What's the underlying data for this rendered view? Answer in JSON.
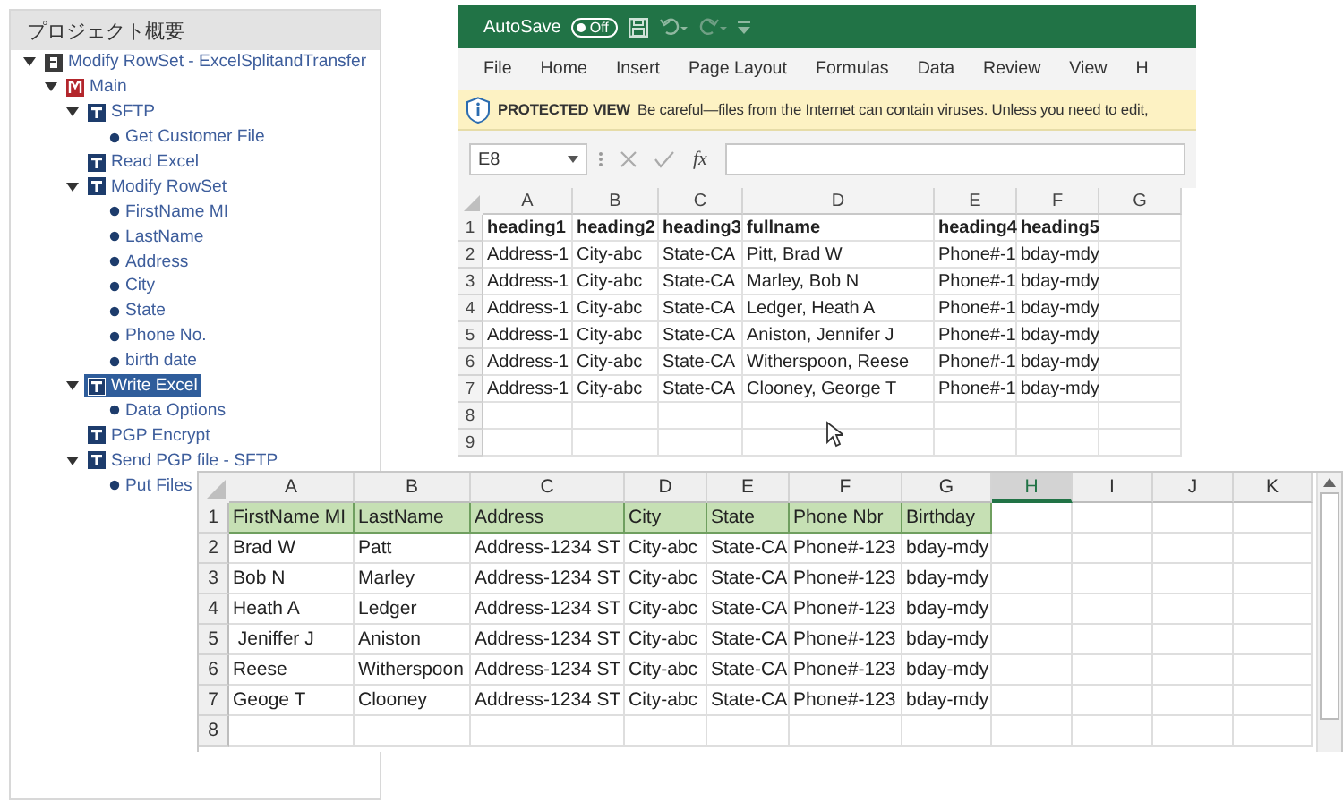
{
  "tree_panel": {
    "title": "プロジェクト概要",
    "items": [
      {
        "label": "Modify RowSet - ExcelSplitandTransfer",
        "kind": "project",
        "expanded": true,
        "selected": false,
        "children": [
          {
            "label": "Main",
            "kind": "module",
            "expanded": true,
            "selected": false,
            "children": [
              {
                "label": "SFTP",
                "kind": "task",
                "expanded": true,
                "selected": false,
                "children": [
                  {
                    "label": "Get Customer File",
                    "kind": "item",
                    "selected": false
                  }
                ]
              },
              {
                "label": "Read Excel",
                "kind": "task",
                "selected": false
              },
              {
                "label": "Modify RowSet",
                "kind": "task",
                "expanded": true,
                "selected": false,
                "children": [
                  {
                    "label": "FirstName MI",
                    "kind": "item",
                    "selected": false
                  },
                  {
                    "label": "LastName",
                    "kind": "item",
                    "selected": false
                  },
                  {
                    "label": "Address",
                    "kind": "item",
                    "selected": false
                  },
                  {
                    "label": "City",
                    "kind": "item",
                    "selected": false
                  },
                  {
                    "label": "State",
                    "kind": "item",
                    "selected": false
                  },
                  {
                    "label": "Phone No.",
                    "kind": "item",
                    "selected": false
                  },
                  {
                    "label": "birth date",
                    "kind": "item",
                    "selected": false
                  }
                ]
              },
              {
                "label": "Write Excel",
                "kind": "task",
                "expanded": true,
                "selected": true,
                "children": [
                  {
                    "label": "Data Options",
                    "kind": "item",
                    "selected": false
                  }
                ]
              },
              {
                "label": "PGP Encrypt",
                "kind": "task",
                "selected": false
              },
              {
                "label": "Send PGP file - SFTP",
                "kind": "task",
                "expanded": true,
                "selected": false,
                "children": [
                  {
                    "label": "Put Files",
                    "kind": "item",
                    "selected": false
                  }
                ]
              }
            ]
          }
        ]
      }
    ]
  },
  "excel_window": {
    "autosave": {
      "label": "AutoSave",
      "state_text": "Off",
      "on": false
    },
    "ribbon_tabs": [
      "File",
      "Home",
      "Insert",
      "Page Layout",
      "Formulas",
      "Data",
      "Review",
      "View",
      "H"
    ],
    "protected_view": {
      "title": "PROTECTED VIEW",
      "message": "Be careful—files from the Internet can contain viruses. Unless you need to edit,"
    },
    "name_box": "E8",
    "function_label": "fx",
    "sheet": {
      "columns": [
        "A",
        "B",
        "C",
        "D",
        "E",
        "F",
        "G"
      ],
      "rows": [
        {
          "number": "1",
          "kind": "header",
          "cells": [
            "heading1",
            "heading2",
            "heading3",
            "fullname",
            "heading4",
            "heading5"
          ]
        },
        {
          "number": "2",
          "kind": "data",
          "cells": [
            "Address-1",
            "City-abc",
            "State-CA",
            "Pitt, Brad W",
            "Phone#-1",
            "bday-mdy"
          ]
        },
        {
          "number": "3",
          "kind": "data",
          "cells": [
            "Address-1",
            "City-abc",
            "State-CA",
            "Marley, Bob N",
            "Phone#-1",
            "bday-mdy"
          ]
        },
        {
          "number": "4",
          "kind": "data",
          "cells": [
            "Address-1",
            "City-abc",
            "State-CA",
            "Ledger, Heath A",
            "Phone#-1",
            "bday-mdy"
          ]
        },
        {
          "number": "5",
          "kind": "data",
          "cells": [
            "Address-1",
            "City-abc",
            "State-CA",
            "Aniston, Jennifer J",
            "Phone#-1",
            "bday-mdy"
          ]
        },
        {
          "number": "6",
          "kind": "data",
          "cells": [
            "Address-1",
            "City-abc",
            "State-CA",
            "Witherspoon, Reese",
            "Phone#-1",
            "bday-mdy"
          ]
        },
        {
          "number": "7",
          "kind": "data",
          "cells": [
            "Address-1",
            "City-abc",
            "State-CA",
            "Clooney, George T",
            "Phone#-1",
            "bday-mdy"
          ]
        },
        {
          "number": "8",
          "kind": "data",
          "cells": []
        },
        {
          "number": "9",
          "kind": "data",
          "cells": []
        }
      ]
    }
  },
  "spreadsheet": {
    "columns": [
      {
        "label": "A",
        "selected": false
      },
      {
        "label": "B",
        "selected": false
      },
      {
        "label": "C",
        "selected": false
      },
      {
        "label": "D",
        "selected": false
      },
      {
        "label": "E",
        "selected": false
      },
      {
        "label": "F",
        "selected": false
      },
      {
        "label": "G",
        "selected": false
      },
      {
        "label": "H",
        "selected": true
      },
      {
        "label": "I",
        "selected": false
      },
      {
        "label": "J",
        "selected": false
      },
      {
        "label": "K",
        "selected": false
      }
    ],
    "rows": [
      {
        "number": "1",
        "kind": "header",
        "cells": [
          "FirstName MI",
          "LastName",
          "Address",
          "City",
          "State",
          "Phone Nbr",
          "Birthday"
        ]
      },
      {
        "number": "2",
        "kind": "data",
        "cells": [
          "Brad W",
          "Patt",
          "Address-1234 ST",
          "City-abc",
          "State-CA",
          "Phone#-123",
          "bday-mdy"
        ]
      },
      {
        "number": "3",
        "kind": "data",
        "cells": [
          "Bob N",
          "Marley",
          "Address-1234 ST",
          "City-abc",
          "State-CA",
          "Phone#-123",
          "bday-mdy"
        ]
      },
      {
        "number": "4",
        "kind": "data",
        "cells": [
          "Heath A",
          "Ledger",
          "Address-1234 ST",
          "City-abc",
          "State-CA",
          "Phone#-123",
          "bday-mdy"
        ]
      },
      {
        "number": "5",
        "kind": "data",
        "cells": [
          " Jeniffer J",
          "Aniston",
          "Address-1234 ST",
          "City-abc",
          "State-CA",
          "Phone#-123",
          "bday-mdy"
        ]
      },
      {
        "number": "6",
        "kind": "data",
        "cells": [
          "Reese",
          "Witherspoon",
          "Address-1234 ST",
          "City-abc",
          "State-CA",
          "Phone#-123",
          "bday-mdy"
        ]
      },
      {
        "number": "7",
        "kind": "data",
        "cells": [
          "Geoge T",
          "Clooney",
          "Address-1234 ST",
          "City-abc",
          "State-CA",
          "Phone#-123",
          "bday-mdy"
        ]
      },
      {
        "number": "8",
        "kind": "data",
        "cells": []
      }
    ]
  }
}
